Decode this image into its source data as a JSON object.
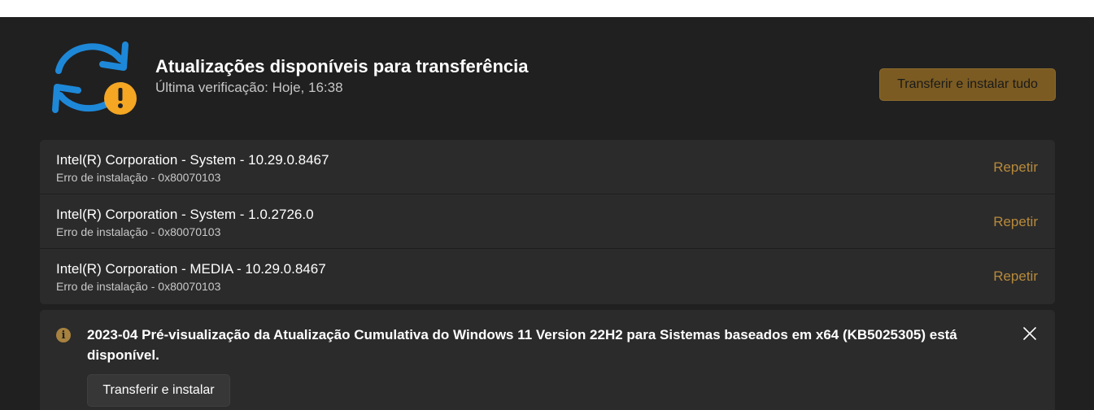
{
  "header": {
    "icon": "sync-warning-icon",
    "title": "Atualizações disponíveis para transferência",
    "subtitle": "Última verificação: Hoje, 16:38",
    "primary_button": "Transferir e instalar tudo"
  },
  "updates": [
    {
      "name": "Intel(R) Corporation - System - 10.29.0.8467",
      "status": "Erro de instalação - 0x80070103",
      "action": "Repetir"
    },
    {
      "name": "Intel(R) Corporation - System - 1.0.2726.0",
      "status": "Erro de instalação - 0x80070103",
      "action": "Repetir"
    },
    {
      "name": "Intel(R) Corporation - MEDIA - 10.29.0.8467",
      "status": "Erro de instalação - 0x80070103",
      "action": "Repetir"
    }
  ],
  "info_bar": {
    "icon": "info-icon",
    "message": "2023-04 Pré-visualização da Atualização Cumulativa do Windows 11 Version 22H2 para Sistemas baseados em x64 (KB5025305) está disponível.",
    "button": "Transferir e instalar",
    "close_icon": "close-icon"
  },
  "colors": {
    "background": "#202020",
    "card": "#2b2b2b",
    "accent": "#b88a3b",
    "accent_button": "#7b5b22",
    "sync_blue": "#1e88d8",
    "warning_yellow": "#f5a623"
  }
}
